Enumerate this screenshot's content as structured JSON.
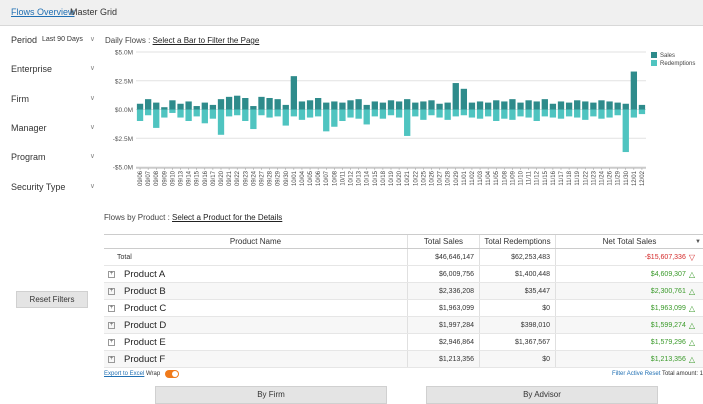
{
  "tabs": [
    {
      "label": "Flows Overview",
      "active": true
    },
    {
      "label": "Master Grid",
      "active": false
    }
  ],
  "filters": {
    "period": {
      "label": "Period",
      "value": "Last 90 Days"
    },
    "enterprise": {
      "label": "Enterprise"
    },
    "firm": {
      "label": "Firm"
    },
    "manager": {
      "label": "Manager"
    },
    "program": {
      "label": "Program"
    },
    "security_type": {
      "label": "Security Type"
    },
    "reset_label": "Reset Filters"
  },
  "daily_chart": {
    "title_prefix": "Daily Flows : ",
    "title_link": "Select a Bar to Filter the Page"
  },
  "chart_data": {
    "type": "bar",
    "ylabel": "",
    "xlabel": "",
    "ylim": [
      -5,
      5
    ],
    "y_ticks": [
      "$5.0M",
      "$2.5M",
      "$0.0M",
      "-$2.5M",
      "-$5.0M"
    ],
    "y_tick_values": [
      5,
      2.5,
      0,
      -2.5,
      -5
    ],
    "grid": true,
    "legend_position": "top-right",
    "categories": [
      "09/06",
      "09/07",
      "09/08",
      "09/09",
      "09/10",
      "09/13",
      "09/14",
      "09/15",
      "09/16",
      "09/17",
      "09/20",
      "09/21",
      "09/22",
      "09/23",
      "09/24",
      "09/27",
      "09/28",
      "09/29",
      "09/30",
      "10/01",
      "10/04",
      "10/05",
      "10/06",
      "10/07",
      "10/08",
      "10/11",
      "10/12",
      "10/13",
      "10/14",
      "10/15",
      "10/18",
      "10/19",
      "10/20",
      "10/21",
      "10/22",
      "10/25",
      "10/26",
      "10/27",
      "10/28",
      "10/29",
      "11/01",
      "11/02",
      "11/03",
      "11/04",
      "11/05",
      "11/08",
      "11/09",
      "11/10",
      "11/11",
      "11/12",
      "11/15",
      "11/16",
      "11/17",
      "11/18",
      "11/19",
      "11/22",
      "11/23",
      "11/24",
      "11/26",
      "11/29",
      "11/30",
      "12/01",
      "12/02"
    ],
    "series": [
      {
        "name": "Sales",
        "color": "#2e8b8b",
        "values": [
          0.5,
          0.9,
          0.6,
          0.2,
          0.8,
          0.5,
          0.7,
          0.3,
          0.6,
          0.4,
          0.9,
          1.1,
          1.2,
          1.0,
          0.3,
          1.1,
          1.0,
          0.9,
          0.4,
          2.9,
          0.7,
          0.8,
          1.0,
          0.6,
          0.7,
          0.6,
          0.8,
          0.9,
          0.4,
          0.7,
          0.6,
          0.8,
          0.7,
          0.9,
          0.6,
          0.7,
          0.8,
          0.5,
          0.6,
          2.3,
          1.8,
          0.6,
          0.7,
          0.6,
          0.8,
          0.7,
          0.9,
          0.6,
          0.8,
          0.7,
          0.9,
          0.5,
          0.7,
          0.6,
          0.8,
          0.7,
          0.6,
          0.8,
          0.7,
          0.6,
          0.5,
          3.3,
          0.4
        ]
      },
      {
        "name": "Redemptions",
        "color": "#4fc4c0",
        "values": [
          -1.0,
          -0.5,
          -1.6,
          -0.7,
          -0.3,
          -0.7,
          -1.0,
          -0.6,
          -1.2,
          -0.8,
          -2.2,
          -0.6,
          -0.5,
          -1.0,
          -1.7,
          -0.5,
          -0.7,
          -0.6,
          -1.4,
          -0.6,
          -0.9,
          -0.7,
          -0.6,
          -1.9,
          -1.5,
          -1.0,
          -0.7,
          -0.8,
          -1.3,
          -0.6,
          -0.8,
          -0.5,
          -0.7,
          -2.3,
          -0.6,
          -0.9,
          -0.5,
          -0.7,
          -0.9,
          -0.6,
          -0.5,
          -0.7,
          -0.8,
          -0.6,
          -1.0,
          -0.8,
          -0.9,
          -0.6,
          -0.7,
          -1.0,
          -0.6,
          -0.7,
          -0.8,
          -0.6,
          -0.7,
          -0.9,
          -0.6,
          -0.8,
          -0.7,
          -0.5,
          -3.7,
          -0.7,
          -0.4
        ]
      }
    ]
  },
  "product_table": {
    "title_prefix": "Flows by Product : ",
    "title_link": "Select a Product for the Details",
    "columns": [
      "Product Name",
      "Total Sales",
      "Total Redemptions",
      "Net Total Sales"
    ],
    "total": {
      "label": "Total",
      "sales": "$46,646,147",
      "redemptions": "$62,253,483",
      "net": "-$15,607,336"
    },
    "rows": [
      {
        "name": "Product A",
        "sales": "$6,009,756",
        "redemptions": "$1,400,448",
        "net": "$4,609,307"
      },
      {
        "name": "Product B",
        "sales": "$2,336,208",
        "redemptions": "$35,447",
        "net": "$2,300,761"
      },
      {
        "name": "Product C",
        "sales": "$1,963,099",
        "redemptions": "$0",
        "net": "$1,963,099"
      },
      {
        "name": "Product D",
        "sales": "$1,997,284",
        "redemptions": "$398,010",
        "net": "$1,599,274"
      },
      {
        "name": "Product E",
        "sales": "$2,946,864",
        "redemptions": "$1,367,567",
        "net": "$1,579,296"
      },
      {
        "name": "Product F",
        "sales": "$1,213,356",
        "redemptions": "$0",
        "net": "$1,213,356"
      }
    ],
    "export_label": "Export to Excel",
    "wrap_label": "Wrap",
    "filter_active_reset": "Filter Active Reset",
    "total_amount_label": "Total amount: 1"
  },
  "bottom_buttons": {
    "by_firm": "By Firm",
    "by_advisor": "By Advisor"
  }
}
